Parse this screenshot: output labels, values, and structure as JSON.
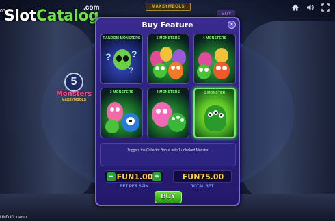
{
  "branding": {
    "logo_prefix": "Slot",
    "logo_suffix": "Catalog",
    "logo_domain": ".com",
    "logo_corner": "00"
  },
  "header": {
    "max_symbols_label": "MAXSYMBOLS",
    "buy_tab_label": "BUY"
  },
  "top_icons": [
    "home-icon",
    "sound-icon",
    "fullscreen-icon"
  ],
  "side_logo": {
    "number": "5",
    "title": "Monsters",
    "subtitle": "MAXSYMBOLS"
  },
  "modal": {
    "title": "Buy Feature",
    "close_label": "✕",
    "options": [
      {
        "label": "RANDOM MONSTERS"
      },
      {
        "label": "5 MONSTERS"
      },
      {
        "label": "4 MONSTERS"
      },
      {
        "label": "3 MONSTERS"
      },
      {
        "label": "2 MONSTERS"
      },
      {
        "label": "1 MONSTER"
      }
    ],
    "selected_option": "1 MONSTER",
    "description": "Triggers the Collector Bonus with 1 unlocked Monster.",
    "bet_value": "FUN1.00",
    "bet_label": "BET PER SPIN",
    "total_value": "FUN75.00",
    "total_label": "TOTAL BET",
    "minus_label": "−",
    "plus_label": "+",
    "buy_label": "BUY"
  },
  "footer": {
    "round_id": "UND ID: demo"
  }
}
